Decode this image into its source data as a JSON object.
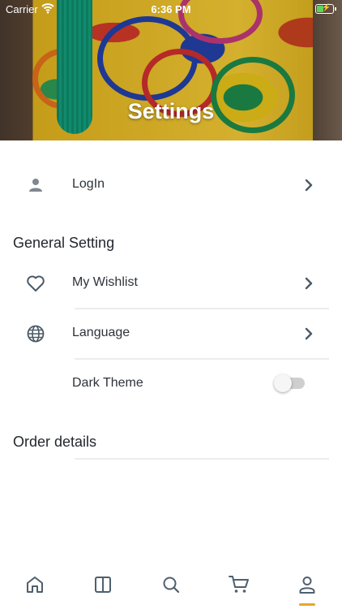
{
  "status_bar": {
    "carrier": "Carrier",
    "time": "6:36 PM"
  },
  "header": {
    "title": "Settings"
  },
  "login": {
    "label": "LogIn",
    "icon": "person-icon"
  },
  "general": {
    "title": "General Setting",
    "items": [
      {
        "label": "My Wishlist",
        "icon": "heart-icon"
      },
      {
        "label": "Language",
        "icon": "globe-icon"
      },
      {
        "label": "Dark Theme",
        "icon": "moon-icon",
        "toggle_on": false
      }
    ]
  },
  "order": {
    "title": "Order details"
  },
  "tabbar": {
    "tabs": [
      {
        "icon": "home-icon",
        "active": false
      },
      {
        "icon": "book-icon",
        "active": false
      },
      {
        "icon": "search-icon",
        "active": false
      },
      {
        "icon": "cart-icon",
        "active": false
      },
      {
        "icon": "profile-icon",
        "active": true
      }
    ],
    "active_color": "#e8a62b",
    "icon_color": "#4f5f6d"
  }
}
